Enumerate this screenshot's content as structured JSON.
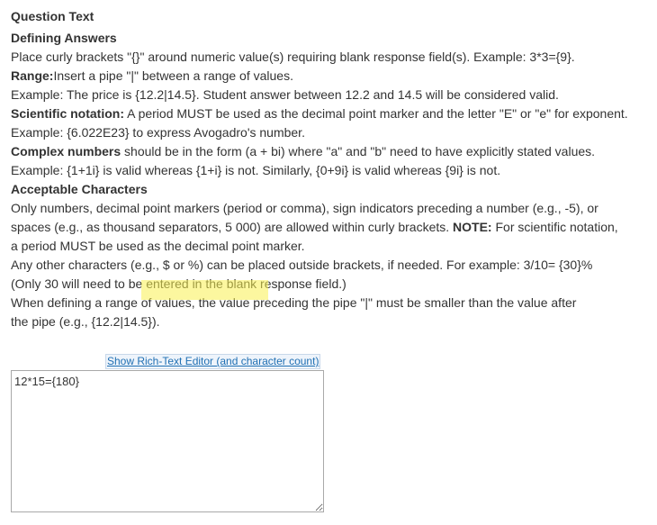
{
  "header": {
    "title": "Question Text"
  },
  "instructions": {
    "defining_title": "Defining Answers",
    "line_curly": "Place curly brackets \"{}\" around numeric value(s) requiring blank response field(s). Example: 3*3={9}.",
    "range_label": "Range:",
    "range_text": "Insert a pipe \"|\" between a range of values.",
    "range_example": "Example: The price is {12.2|14.5}. Student answer between 12.2 and 14.5 will be considered valid.",
    "sci_label": "Scientific notation:",
    "sci_text": " A period MUST be used as the decimal point marker and the letter \"E\" or \"e\" for exponent.",
    "sci_example": "Example: {6.022E23} to express Avogadro's number.",
    "complex_label": "Complex numbers",
    "complex_text": " should be in the form (a + bi) where \"a\" and \"b\" need to have explicitly stated values.",
    "complex_example": "Example: {1+1i} is valid whereas {1+i} is not. Similarly, {0+9i} is valid whereas {9i} is not.",
    "acceptable_title": "Acceptable Characters",
    "acc_line1": "Only numbers, decimal point markers (period or comma), sign indicators preceding a number (e.g., -5), or",
    "acc_line2a": "spaces (e.g., as thousand separators, 5 000) are allowed within curly brackets. ",
    "acc_note_label": "NOTE:",
    "acc_line2b": " For scientific notation,",
    "acc_line3": "a period MUST be used as the decimal point marker.",
    "acc_line4": "Any other characters (e.g., $ or %) can be placed outside brackets, if needed. For example: 3/10= {30}%",
    "acc_line5": "(Only 30 will need to be entered in the blank response field.)",
    "acc_line6": "When defining a range of values, the value preceding the pipe \"|\" must be smaller than the value after",
    "acc_line7": "the pipe (e.g., {12.2|14.5})."
  },
  "editor": {
    "toggle_link": "Show Rich-Text Editor (and character count)",
    "answer_value": "12*15={180}"
  },
  "colors": {
    "highlight": "#faf050",
    "link": "#1f6fb3"
  }
}
